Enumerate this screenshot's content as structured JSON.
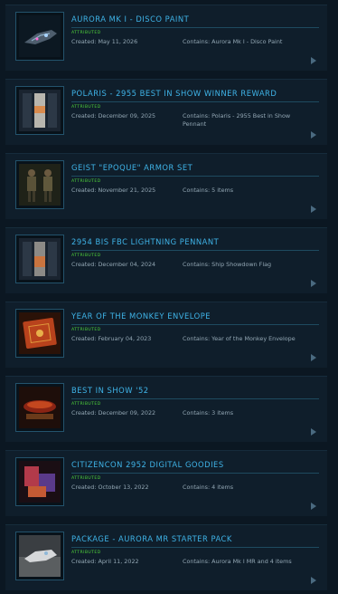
{
  "items": [
    {
      "title": "AURORA MK I - DISCO PAINT",
      "badge": "ATTRIBUTED",
      "created": "Created: May 11, 2026",
      "contains": "Contains: Aurora Mk I - Disco Paint",
      "thumb_icon": "ship-icon"
    },
    {
      "title": "POLARIS - 2955 BEST IN SHOW WINNER REWARD",
      "badge": "ATTRIBUTED",
      "created": "Created: December 09, 2025",
      "contains": "Contains: Polaris - 2955 Best in Show Pennant",
      "thumb_icon": "pennant-icon"
    },
    {
      "title": "GEIST \"EPOQUE\" ARMOR SET",
      "badge": "ATTRIBUTED",
      "created": "Created: November 21, 2025",
      "contains": "Contains: 5 items",
      "thumb_icon": "armor-icon"
    },
    {
      "title": "2954 BIS FBC LIGHTNING PENNANT",
      "badge": "ATTRIBUTED",
      "created": "Created: December 04, 2024",
      "contains": "Contains: Ship Showdown Flag",
      "thumb_icon": "pennant-icon"
    },
    {
      "title": "YEAR OF THE MONKEY ENVELOPE",
      "badge": "ATTRIBUTED",
      "created": "Created: February 04, 2023",
      "contains": "Contains: Year of the Monkey Envelope",
      "thumb_icon": "envelope-icon"
    },
    {
      "title": "BEST IN SHOW '52",
      "badge": "ATTRIBUTED",
      "created": "Created: December 09, 2022",
      "contains": "Contains: 3 items",
      "thumb_icon": "trophy-icon"
    },
    {
      "title": "CITIZENCON 2952 DIGITAL GOODIES",
      "badge": "ATTRIBUTED",
      "created": "Created: October 13, 2022",
      "contains": "Contains: 4 items",
      "thumb_icon": "goodies-icon"
    },
    {
      "title": "PACKAGE - AURORA MR STARTER PACK",
      "badge": "ATTRIBUTED",
      "created": "Created: April 11, 2022",
      "contains": "Contains: Aurora Mk I MR and 4 items",
      "thumb_icon": "ship-icon"
    }
  ],
  "colors": {
    "accent": "#3fb4e8",
    "badge": "#4fd13a",
    "meta": "#93a7b4",
    "panel": "#0f1e2b",
    "background": "#0b1722"
  }
}
